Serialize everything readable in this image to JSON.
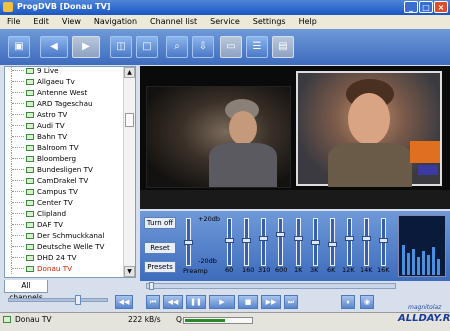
{
  "window": {
    "title": "ProgDVB [Donau TV]",
    "min": "_",
    "max": "□",
    "close": "×"
  },
  "menu": [
    "File",
    "Edit",
    "View",
    "Navigation",
    "Channel list",
    "Service",
    "Settings",
    "Help"
  ],
  "toolbar_icons": [
    "window-icon",
    "back-icon",
    "forward-icon",
    "split-icon",
    "full-icon",
    "zoom-icon",
    "download-icon",
    "record-icon",
    "list-icon",
    "info-icon"
  ],
  "channels": [
    "9 Live",
    "Allgaeu Tv",
    "Antenne West",
    "ARD Tageschau",
    "Astro TV",
    "Audi TV",
    "Bahn TV",
    "Balroom TV",
    "Bloomberg",
    "Bundesligen TV",
    "CamDrakel TV",
    "Campus TV",
    "Center TV",
    "Clipland",
    "DAF TV",
    "Der Schmuckkanal",
    "Deutsche Welle TV",
    "DHD 24 TV",
    "Donau TV"
  ],
  "selected_channel": "Donau TV",
  "tab_label": "All channels",
  "equalizer": {
    "buttons": {
      "turn_off": "Turn off",
      "reset": "Reset",
      "presets": "Presets"
    },
    "db_top": "+20db",
    "db_bottom": "-20db",
    "preamp_label": "Preamp",
    "bands": [
      "60",
      "160",
      "310",
      "600",
      "1K",
      "3K",
      "6K",
      "12K",
      "14K",
      "16K"
    ],
    "levels": [
      0.5,
      0.45,
      0.45,
      0.4,
      0.3,
      0.4,
      0.5,
      0.55,
      0.4,
      0.4,
      0.45
    ]
  },
  "status": {
    "channel": "Donau TV",
    "bitrate": "222 kB/s",
    "q_label": "Q",
    "signal_level": 0.6
  },
  "watermark": {
    "site": "ALLDAY.RU",
    "sub": "magnitolaz"
  },
  "colors": {
    "selected_text": "#cc2200",
    "toolbar": "#3e6cbd"
  }
}
